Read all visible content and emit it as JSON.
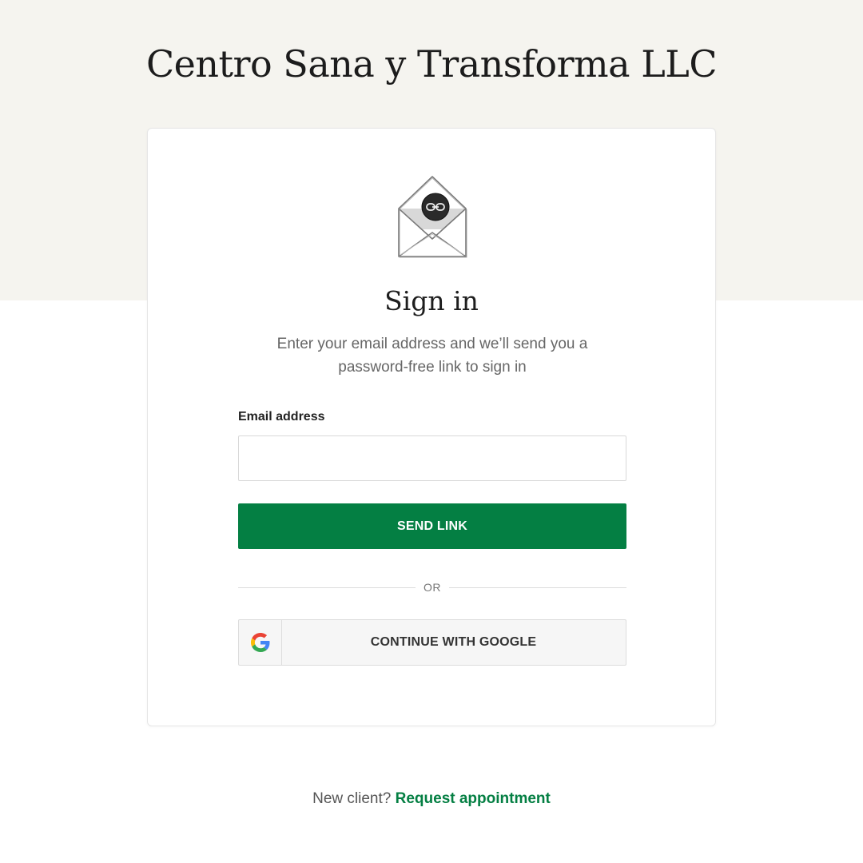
{
  "header": {
    "practice_name": "Centro Sana y Transforma LLC"
  },
  "signin_card": {
    "illustration": "envelope-link-icon",
    "title": "Sign in",
    "description": "Enter your email address and we’ll send you a password-free link to sign in",
    "email_label": "Email address",
    "email_value": "",
    "email_placeholder": "",
    "send_button_label": "SEND LINK",
    "divider_text": "OR",
    "google_icon": "google-g-icon",
    "google_button_label": "CONTINUE WITH GOOGLE"
  },
  "footer": {
    "prompt": "New client?",
    "link_label": "Request appointment"
  },
  "colors": {
    "top_band": "#f5f4ef",
    "accent_green": "#047f43",
    "card_border": "#e6e6e6",
    "google_button_bg": "#f6f6f6"
  }
}
